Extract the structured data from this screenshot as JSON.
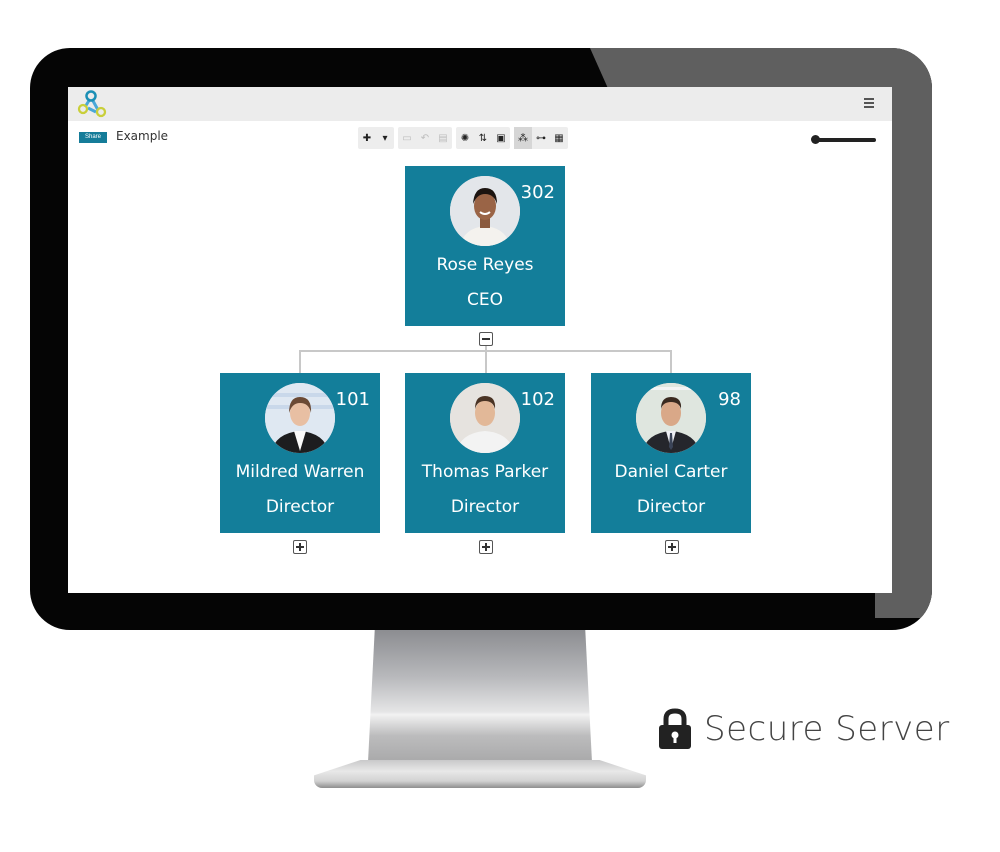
{
  "app": {
    "document_title": "Example",
    "share_label": "Share",
    "menu_icon": "hamburger-icon",
    "logo_icon": "org-chart-logo-icon"
  },
  "toolbar": {
    "groups": [
      [
        {
          "icon": "plus-icon",
          "glyph": "✚",
          "enabled": true
        },
        {
          "icon": "caret-down-icon",
          "glyph": "▾",
          "enabled": true
        }
      ],
      [
        {
          "icon": "save-icon",
          "glyph": "▭",
          "enabled": false
        },
        {
          "icon": "undo-icon",
          "glyph": "↶",
          "enabled": false
        },
        {
          "icon": "delete-icon",
          "glyph": "▤",
          "enabled": false
        }
      ],
      [
        {
          "icon": "settings-icon",
          "glyph": "✺",
          "enabled": true
        },
        {
          "icon": "sort-icon",
          "glyph": "⇅",
          "enabled": true
        },
        {
          "icon": "screenshot-icon",
          "glyph": "▣",
          "enabled": true
        }
      ],
      [
        {
          "icon": "tree-layout-icon",
          "glyph": "⁂",
          "enabled": true,
          "active": true
        },
        {
          "icon": "hierarchy-layout-icon",
          "glyph": "⊶",
          "enabled": true
        },
        {
          "icon": "grid-layout-icon",
          "glyph": "▦",
          "enabled": true
        }
      ]
    ]
  },
  "zoom": {
    "level": 0.05
  },
  "org": {
    "root": {
      "name": "Rose Reyes",
      "title": "CEO",
      "count": "302",
      "expanded": true
    },
    "children": [
      {
        "name": "Mildred Warren",
        "title": "Director",
        "count": "101",
        "expanded": false
      },
      {
        "name": "Thomas Parker",
        "title": "Director",
        "count": "102",
        "expanded": false
      },
      {
        "name": "Daniel Carter",
        "title": "Director",
        "count": "98",
        "expanded": false
      }
    ]
  },
  "badge": {
    "text": "Secure Server",
    "icon": "lock-icon"
  },
  "colors": {
    "card": "#137e9a",
    "share": "#157c99"
  }
}
